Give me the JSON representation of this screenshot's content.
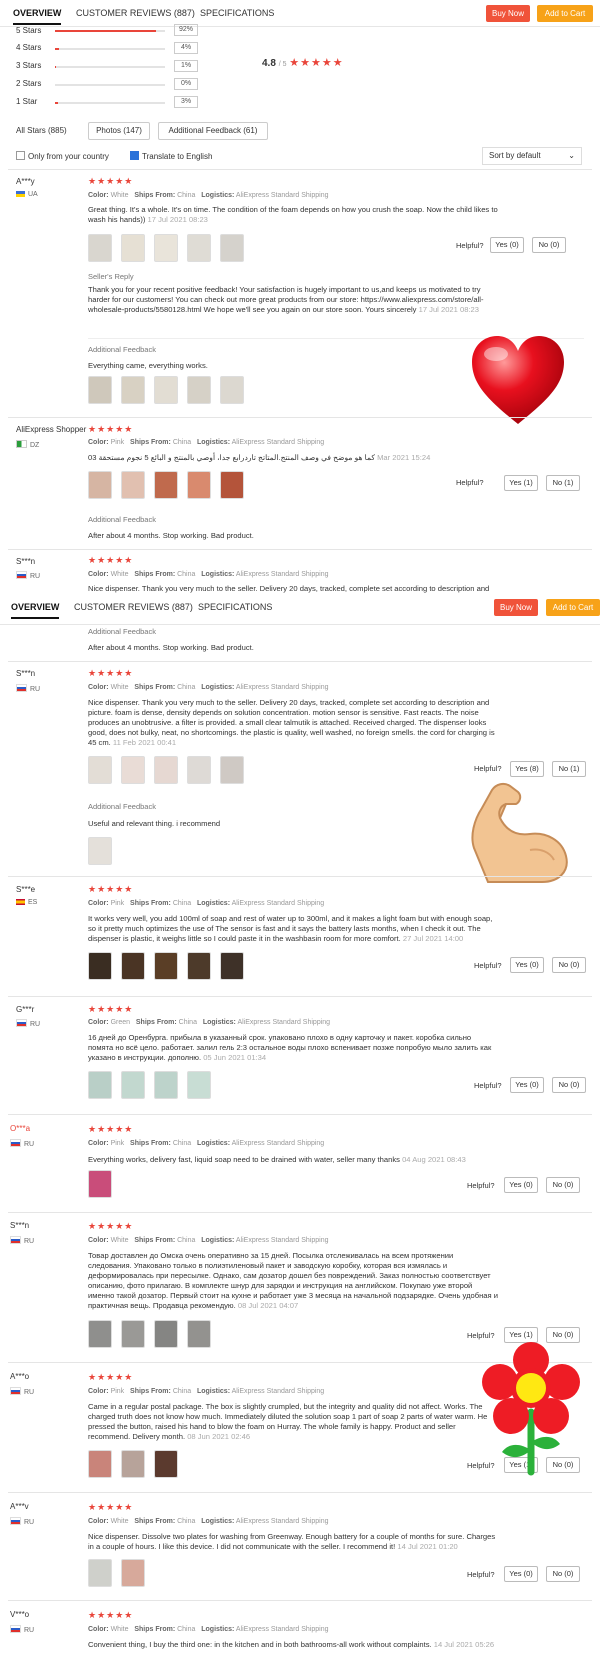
{
  "header": {
    "tabs": [
      "OVERVIEW",
      "CUSTOMER REVIEWS (887)",
      "SPECIFICATIONS"
    ],
    "buy_now": "Buy Now",
    "add_to_cart": "Add to Cart"
  },
  "ratings": {
    "rows": [
      {
        "label": "5 Stars",
        "pct": "92%",
        "value": 0.92
      },
      {
        "label": "4 Stars",
        "pct": "4%",
        "value": 0.04
      },
      {
        "label": "3 Stars",
        "pct": "1%",
        "value": 0.01
      },
      {
        "label": "2 Stars",
        "pct": "0%",
        "value": 0
      },
      {
        "label": "1 Star",
        "pct": "3%",
        "value": 0.03
      }
    ],
    "score": "4.8",
    "out_of": "/ 5",
    "stars": "★★★★★"
  },
  "filters": {
    "all_stars": "All Stars (885)",
    "photos": "Photos (147)",
    "additional_feedback": "Additional Feedback (61)",
    "only_country": "Only from your country",
    "translate": "Translate to English",
    "sort": "Sort by default"
  },
  "labels": {
    "color": "Color:",
    "ships_from": "Ships From:",
    "logistics": "Logistics:",
    "helpful": "Helpful?",
    "sellers_reply": "Seller's Reply",
    "additional_feedback": "Additional Feedback",
    "stars": "★★★★★"
  },
  "reviews1": [
    {
      "name": "A***y",
      "country": "UA",
      "color": "White",
      "ships": "China",
      "logistics": "AliExpress Standard Shipping",
      "text": "Great thing. It's a whole. It's on time. The condition of the foam depends on how you crush the soap. Now the child likes to wash his hands))",
      "date": "17 Jul 2021 08:23",
      "yes": "Yes (0)",
      "no": "No (0)",
      "reply": "Thank you for your recent positive feedback! Your satisfaction is hugely important to us,and keeps us motivated to try harder for our customers! You can check out more great products from our store: https://www.aliexpress.com/store/all-wholesale-products/5580128.html We hope we'll see you again on our store soon. Yours sincerely",
      "reply_date": "17 Jul 2021 08:23",
      "additional": "Everything came, everything works."
    },
    {
      "name": "AliExpress Shopper",
      "country": "DZ",
      "color": "Pink",
      "ships": "China",
      "logistics": "AliExpress Standard Shipping",
      "text": "كما هو موضح في وصف المنتج.المتاتج تاردرابع جدا، أوصي بالمنتج و البائع 5 نجوم مستحقة 03",
      "date": "Mar 2021 15:24",
      "yes": "Yes (1)",
      "no": "No (1)",
      "additional": "After about 4 months. Stop working. Bad product."
    },
    {
      "name": "S***n",
      "country": "RU",
      "color": "White",
      "ships": "China",
      "logistics": "AliExpress Standard Shipping",
      "text": "Nice dispenser. Thank you very much to the seller. Delivery 20 days, tracked, complete set according to description and"
    }
  ],
  "reviews2": [
    {
      "name": "S***n",
      "country": "RU",
      "color": "White",
      "ships": "China",
      "logistics": "AliExpress Standard Shipping",
      "text": "Nice dispenser. Thank you very much to the seller. Delivery 20 days, tracked, complete set according to description and picture. foam is dense, density depends on solution concentration. motion sensor is sensitive. Fast reacts. The noise produces an unobtrusive. a filter is provided. a small clear talmutik is attached. Received charged. The dispenser looks good, does not bulky, neat, no shortcomings. the plastic is quality, well washed, no foreign smells. the cord for charging is 45 cm.",
      "date": "11 Feb 2021 00:41",
      "yes": "Yes (8)",
      "no": "No (1)",
      "additional": "Useful and relevant thing. i recommend"
    },
    {
      "name": "S***e",
      "country": "ES",
      "color": "Pink",
      "ships": "China",
      "logistics": "AliExpress Standard Shipping",
      "text": "It works very well, you add 100ml of soap and rest of water up to 300ml, and it makes a light foam but with enough soap, so it pretty much optimizes the use of The sensor is fast and it says the battery lasts months, when I check it out. The dispenser is plastic, it weighs little so I could paste it in the washbasin room for more comfort.",
      "date": "27 Jul 2021 14:00",
      "yes": "Yes (0)",
      "no": "No (0)"
    },
    {
      "name": "G***r",
      "country": "RU",
      "color": "Green",
      "ships": "China",
      "logistics": "AliExpress Standard Shipping",
      "text": "16 дней до Оренбурга. прибыла в указанный срок. упаковано плохо в одну карточку и пакет. коробка сильно помята но всё цело. работает. залил гель 2:3 остальное воды плохо вспенивает позже попробую мыло залить как указано в инструкции. дополню.",
      "date": "05 Jun 2021 01:34",
      "yes": "Yes (0)",
      "no": "No (0)"
    },
    {
      "name": "O***a",
      "country": "RU",
      "color": "Pink",
      "ships": "China",
      "logistics": "AliExpress Standard Shipping",
      "text": "Everything works, delivery fast, liquid soap need to be drained with water, seller many thanks",
      "date": "04 Aug 2021 08:43",
      "yes": "Yes (0)",
      "no": "No (0)"
    },
    {
      "name": "S***n",
      "country": "RU",
      "color": "White",
      "ships": "China",
      "logistics": "AliExpress Standard Shipping",
      "text": "Товар доставлен до Омска очень оперативно за 15 дней. Посылка отслеживалась на всем протяжении следования. Упаковано только в полиэтиленовый пакет и заводскую коробку, которая вся измялась и деформировалась при пересылке. Однако, сам дозатор дошел без повреждений. Заказ полностью соответствует описанию, фото прилагаю. В комплекте шнур для зарядки и инструкция на английском. Покупаю уже второй именно такой дозатор. Первый стоит на кухне и работает уже 3 месяца на начальной подзарядке. Очень удобная и практичная вещь. Продавца рекомендую.",
      "date": "08 Jul 2021 04:07",
      "yes": "Yes (1)",
      "no": "No (0)"
    },
    {
      "name": "A***o",
      "country": "RU",
      "color": "Pink",
      "ships": "China",
      "logistics": "AliExpress Standard Shipping",
      "text": "Came in a regular postal package. The box is slightly crumpled, but the integrity and quality did not affect. Works. The charged truth does not know how much. Immediately diluted the solution soap 1 part of soap 2 parts of water warm. He pressed the button, raised his hand to blow the foam on Hurray. The whole family is happy. Product and seller recommend. Delivery month.",
      "date": "08 Jun 2021 02:46",
      "yes": "Yes (1)",
      "no": "No (0)"
    },
    {
      "name": "A***v",
      "country": "RU",
      "color": "White",
      "ships": "China",
      "logistics": "AliExpress Standard Shipping",
      "text": "Nice dispenser. Dissolve two plates for washing from Greenway. Enough battery for a couple of months for sure. Charges in a couple of hours. I like this device. I did not communicate with the seller. I recommend it!",
      "date": "14 Jul 2021 01:20",
      "yes": "Yes (0)",
      "no": "No (0)"
    },
    {
      "name": "V***o",
      "country": "RU",
      "color": "White",
      "ships": "China",
      "logistics": "AliExpress Standard Shipping",
      "text": "Convenient thing, I buy the third one: in the kitchen and in both bathrooms-all work without complaints.",
      "date": "14 Jul 2021 05:26"
    }
  ],
  "colors": {
    "accent": "#e9453a",
    "buy": "#f0533a",
    "cart": "#f7a218"
  }
}
